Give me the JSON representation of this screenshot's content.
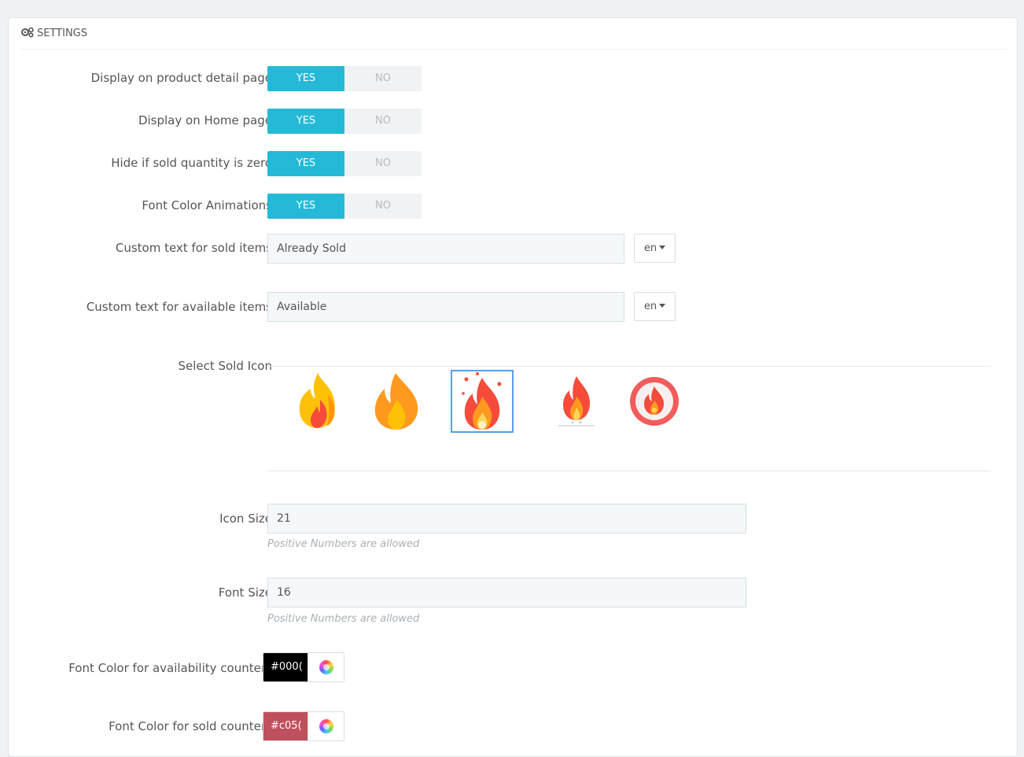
{
  "header": {
    "title": "SETTINGS",
    "icon": "gears-icon"
  },
  "toggles": [
    {
      "label": "Display on product detail page",
      "yes": "YES",
      "no": "NO",
      "value": "YES"
    },
    {
      "label": "Display on Home page",
      "yes": "YES",
      "no": "NO",
      "value": "YES"
    },
    {
      "label": "Hide if sold quantity is zero",
      "yes": "YES",
      "no": "NO",
      "value": "YES"
    },
    {
      "label": "Font Color Animations",
      "yes": "YES",
      "no": "NO",
      "value": "YES"
    }
  ],
  "sold_text": {
    "label": "Custom text for sold items",
    "value": "Already Sold",
    "lang": "en"
  },
  "available_text": {
    "label": "Custom text for available items",
    "value": "Available",
    "lang": "en"
  },
  "sold_icon": {
    "label": "Select Sold Icon",
    "options": [
      "flame-icon-1",
      "flame-icon-2",
      "flame-icon-3",
      "flame-icon-4",
      "flame-icon-5"
    ],
    "selected_index": 2
  },
  "icon_size": {
    "label": "Icon Size",
    "value": "21",
    "help": "Positive Numbers are allowed"
  },
  "font_size": {
    "label": "Font Size",
    "value": "16",
    "help": "Positive Numbers are allowed"
  },
  "availability_color": {
    "label": "Font Color for availability counter",
    "value": "#000(",
    "color": "#000000"
  },
  "sold_color": {
    "label": "Font Color for sold counter",
    "value": "#c05(",
    "color": "#c0505d"
  },
  "colors": {
    "accent": "#25b9d7",
    "selected_border": "#5b9ee8"
  }
}
